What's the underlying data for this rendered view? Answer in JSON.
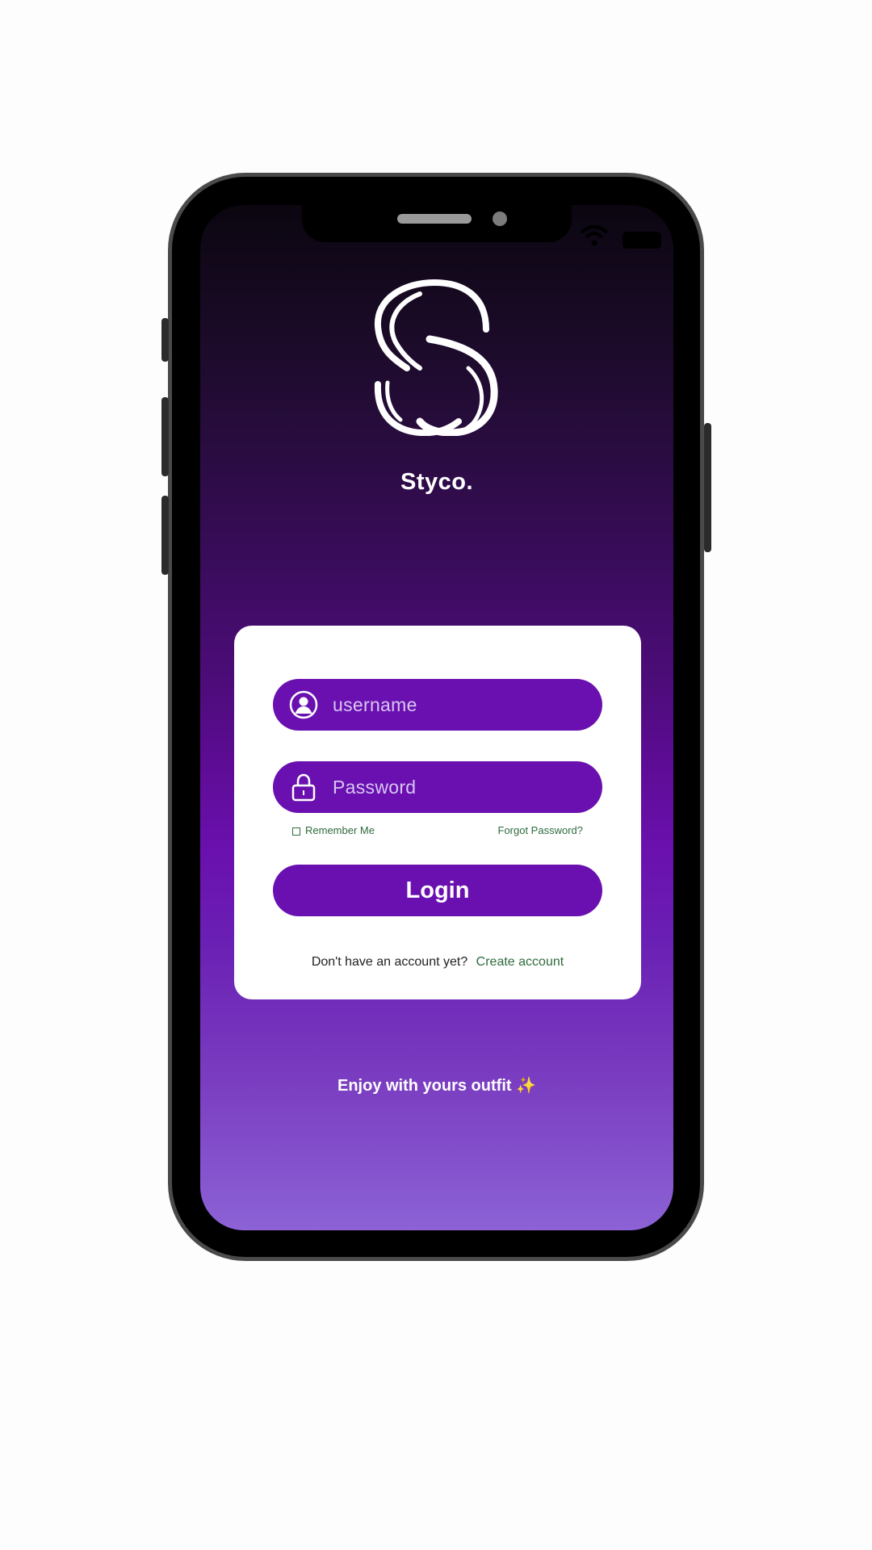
{
  "app": {
    "brand_name": "Styco.",
    "logo_icon": "styco-s-logo-icon",
    "accent_color": "#6a10b0",
    "link_color": "#2f6b3d"
  },
  "login_form": {
    "username_placeholder": "username",
    "username_icon": "user-circle-icon",
    "password_placeholder": "Password",
    "password_icon": "lock-icon",
    "remember_me_label": "Remember Me",
    "remember_me_checked": false,
    "forgot_password_label": "Forgot Password?",
    "login_button_label": "Login",
    "no_account_text": "Don't have an account yet?",
    "create_account_label": "Create account"
  },
  "footer": {
    "tagline": "Enjoy with yours outfit ✨"
  }
}
